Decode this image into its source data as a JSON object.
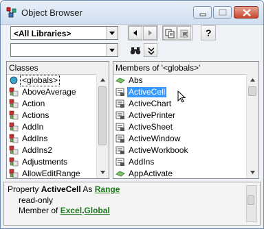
{
  "window": {
    "title": "Object Browser"
  },
  "toolbar": {
    "library_value": "<All Libraries>",
    "search_value": "",
    "help_label": "?"
  },
  "classes": {
    "header": "Classes",
    "items": [
      {
        "label": "<globals>",
        "icon": "globals-icon"
      },
      {
        "label": "AboveAverage",
        "icon": "class-icon"
      },
      {
        "label": "Action",
        "icon": "class-icon"
      },
      {
        "label": "Actions",
        "icon": "class-icon"
      },
      {
        "label": "AddIn",
        "icon": "class-icon"
      },
      {
        "label": "AddIns",
        "icon": "class-icon"
      },
      {
        "label": "AddIns2",
        "icon": "class-icon"
      },
      {
        "label": "Adjustments",
        "icon": "class-icon"
      },
      {
        "label": "AllowEditRange",
        "icon": "class-icon"
      }
    ]
  },
  "members": {
    "header": "Members of '<globals>'",
    "items": [
      {
        "label": "Abs",
        "icon": "method-icon"
      },
      {
        "label": "ActiveCell",
        "icon": "property-icon"
      },
      {
        "label": "ActiveChart",
        "icon": "property-icon"
      },
      {
        "label": "ActivePrinter",
        "icon": "property-icon"
      },
      {
        "label": "ActiveSheet",
        "icon": "property-icon"
      },
      {
        "label": "ActiveWindow",
        "icon": "property-icon"
      },
      {
        "label": "ActiveWorkbook",
        "icon": "property-icon"
      },
      {
        "label": "AddIns",
        "icon": "property-icon"
      },
      {
        "label": "AppActivate",
        "icon": "method-icon"
      }
    ]
  },
  "details": {
    "kind": "Property",
    "member": "ActiveCell",
    "as_word": "As",
    "type_link": "Range",
    "readonly": "read-only",
    "member_of": "Member of",
    "lib_link": "Excel",
    "dot": ".",
    "class_link": "Global"
  }
}
